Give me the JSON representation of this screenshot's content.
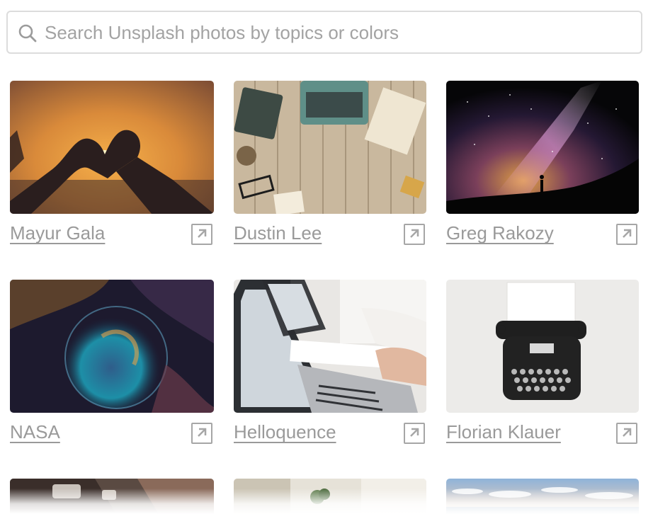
{
  "search": {
    "placeholder": "Search Unsplash photos by topics or colors",
    "value": ""
  },
  "photos": [
    {
      "author": "Mayur Gala",
      "subject": "heart-hands-sunset"
    },
    {
      "author": "Dustin Lee",
      "subject": "typewriter-desk-top-view"
    },
    {
      "author": "Greg Rakozy",
      "subject": "milky-way-silhouette"
    },
    {
      "author": "NASA",
      "subject": "bubble-nebula"
    },
    {
      "author": "Helloquence",
      "subject": "laptop-meeting-notes"
    },
    {
      "author": "Florian Klauer",
      "subject": "vintage-typewriter"
    },
    {
      "author": "",
      "subject": "hands-watch"
    },
    {
      "author": "",
      "subject": "plant-desk"
    },
    {
      "author": "",
      "subject": "clouds-sky"
    }
  ],
  "colors": {
    "link": "#9a9a9a",
    "border": "#dcdcdc",
    "placeholder": "#a3a3a3"
  }
}
